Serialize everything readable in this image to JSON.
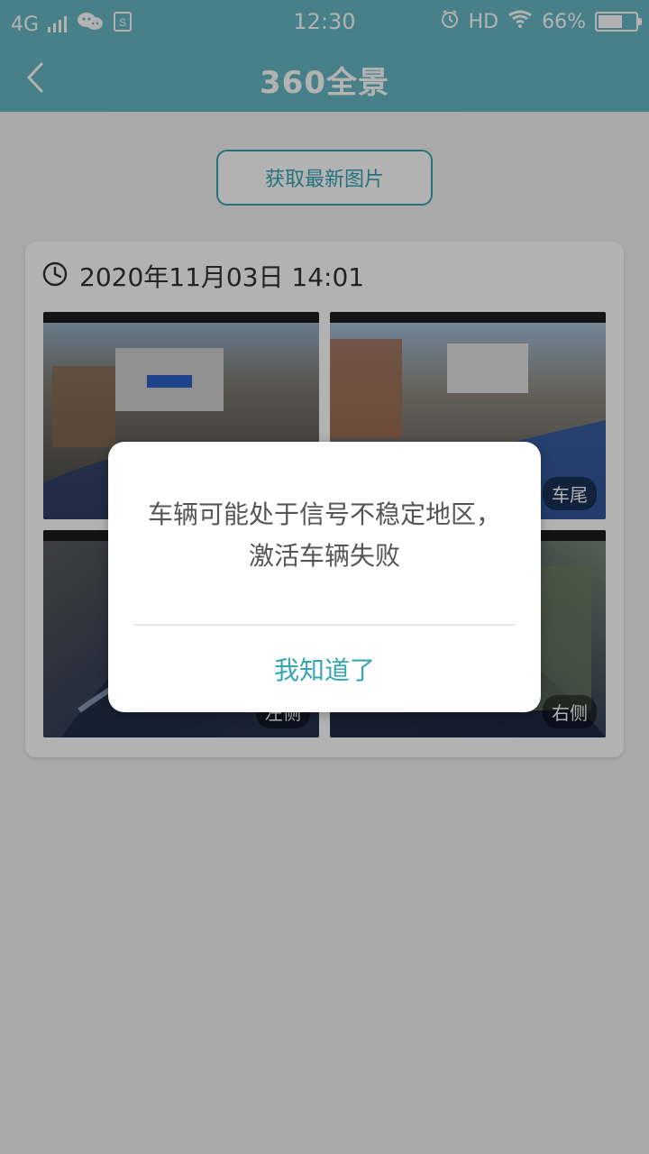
{
  "status_bar": {
    "network": "4G",
    "time": "12:30",
    "hd": "HD",
    "battery_percent": "66%",
    "battery_level": 0.66,
    "icons": [
      "wechat-icon",
      "s-icon",
      "alarm-icon",
      "wifi-icon",
      "battery-icon"
    ]
  },
  "title_bar": {
    "title": "360全景",
    "back_icon": "back-arrow-icon"
  },
  "fetch_button": {
    "label": "获取最新图片"
  },
  "card": {
    "timestamp": "2020年11月03日 14:01",
    "clock_icon": "clock-icon",
    "images": [
      {
        "position": "front",
        "label": ""
      },
      {
        "position": "rear",
        "label": "车尾"
      },
      {
        "position": "left",
        "label": "左侧"
      },
      {
        "position": "right",
        "label": "右侧"
      }
    ]
  },
  "dialog": {
    "message": "车辆可能处于信号不稳定地区，激活车辆失败",
    "button": "我知道了"
  },
  "colors": {
    "header": "#67b8c4",
    "accent": "#36a6b3",
    "text": "#333333",
    "dialog_text": "#555555",
    "background": "#f3f3f3"
  }
}
